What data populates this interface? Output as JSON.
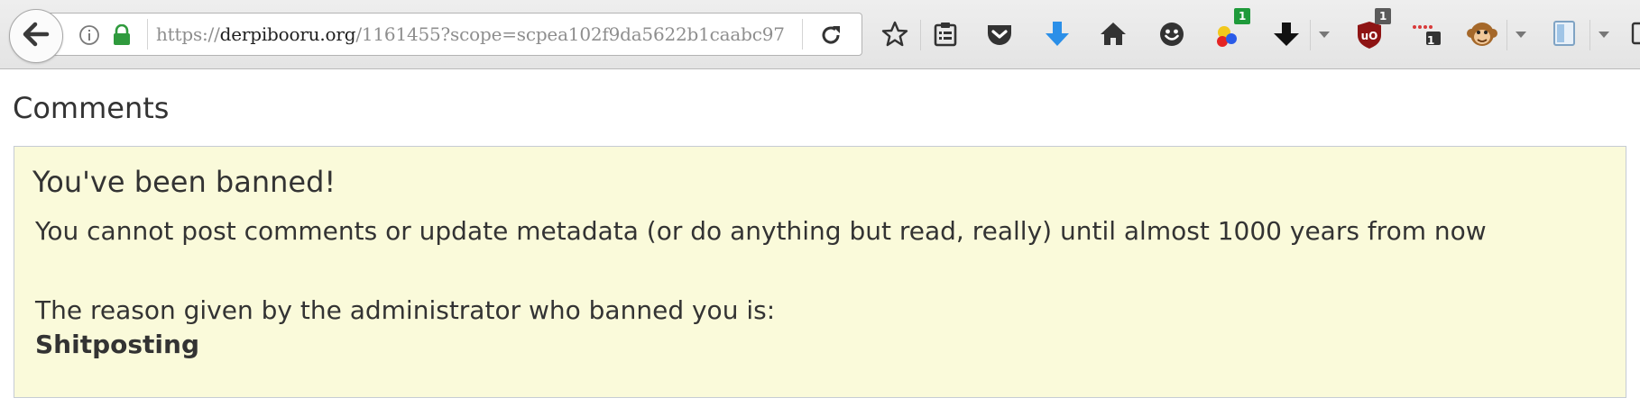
{
  "browser": {
    "url_scheme": "https://",
    "url_host": "derpibooru.org",
    "url_path": "/1161455?scope=scpea102f9da5622b1caabc97",
    "badges": {
      "multicolor_count": "1",
      "ublock_count": "1",
      "counter_count": "1"
    },
    "accent_green": "#1e9a3a",
    "accent_blue": "#2b8fe8"
  },
  "page": {
    "title": "Comments"
  },
  "ban": {
    "heading": "You've been banned!",
    "message": "You cannot post comments or update metadata (or do anything but read, really) until almost 1000 years from now",
    "reason_label": "The reason given by the administrator who banned you is:",
    "reason": "Shitposting",
    "background_color": "#fafada"
  }
}
